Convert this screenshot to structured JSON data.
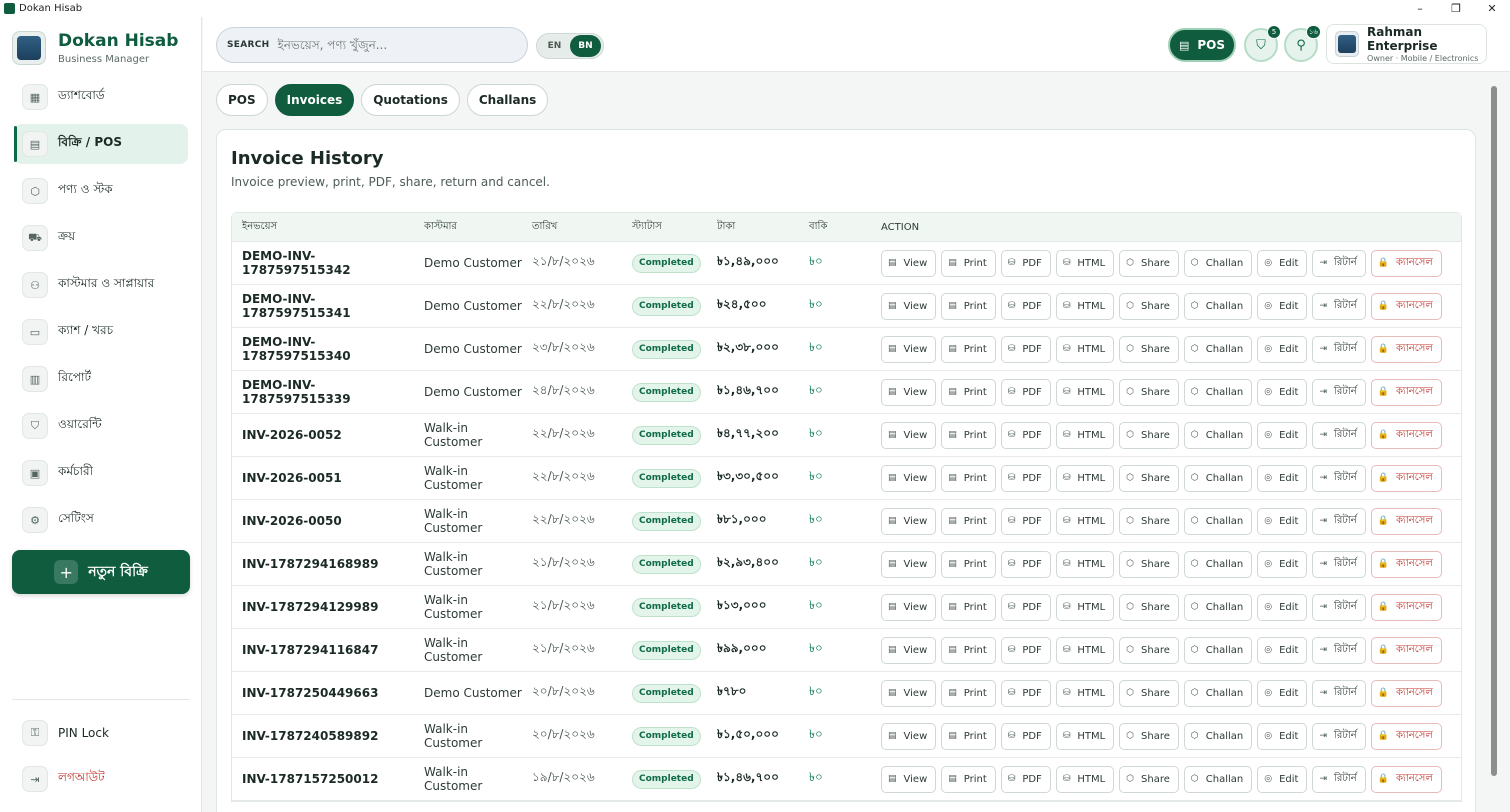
{
  "window": {
    "title": "Dokan Hisab",
    "controls": [
      "–",
      "❐",
      "✕"
    ]
  },
  "brand": {
    "name": "Dokan Hisab",
    "subtitle": "Business Manager"
  },
  "sidebar": {
    "items": [
      {
        "label": "ড্যাশবোর্ড",
        "icon": "dashboard-icon",
        "glyph": "▦"
      },
      {
        "label": "বিক্রি / POS",
        "icon": "receipt-icon",
        "glyph": "▤"
      },
      {
        "label": "পণ্য ও স্টক",
        "icon": "box-icon",
        "glyph": "⬡"
      },
      {
        "label": "ক্রয়",
        "icon": "truck-icon",
        "glyph": "⛟"
      },
      {
        "label": "কাস্টমার ও সাপ্লায়ার",
        "icon": "users-icon",
        "glyph": "⚇"
      },
      {
        "label": "ক্যাশ / খরচ",
        "icon": "wallet-icon",
        "glyph": "▭"
      },
      {
        "label": "রিপোর্ট",
        "icon": "bar-chart-icon",
        "glyph": "▥"
      },
      {
        "label": "ওয়ারেন্টি",
        "icon": "shield-check-icon",
        "glyph": "⛉"
      },
      {
        "label": "কর্মচারী",
        "icon": "calendar-icon",
        "glyph": "▣"
      },
      {
        "label": "সেটিংস",
        "icon": "settings-icon",
        "glyph": "⚙"
      }
    ],
    "active_index": 1,
    "new_sale_label": "নতুন বিক্রি",
    "pin_lock_label": "PIN Lock",
    "logout_label": "লগআউট"
  },
  "header": {
    "search_label": "SEARCH",
    "search_placeholder": "ইনভয়েস, পণ্য খুঁজুন...",
    "lang_en": "EN",
    "lang_bn": "BN",
    "lang_selected": "BN",
    "pos_label": "POS",
    "badge_1": "5",
    "badge_2": "১৬",
    "profile_name": "Rahman Enterprise",
    "profile_role": "Owner · Mobile / Electronics"
  },
  "tabs": [
    {
      "label": "POS",
      "active": false
    },
    {
      "label": "Invoices",
      "active": true
    },
    {
      "label": "Quotations",
      "active": false
    },
    {
      "label": "Challans",
      "active": false
    }
  ],
  "card": {
    "title": "Invoice History",
    "subtitle": "Invoice preview, print, PDF, share, return and cancel."
  },
  "table": {
    "headers": [
      "ইনভয়েস",
      "কাস্টমার",
      "তারিখ",
      "স্ট্যাটাস",
      "টাকা",
      "বাকি",
      "ACTION"
    ],
    "actions": [
      {
        "label": "View",
        "icon": "receipt-icon",
        "glyph": "▤"
      },
      {
        "label": "Print",
        "icon": "printer-icon",
        "glyph": "▤"
      },
      {
        "label": "PDF",
        "icon": "database-icon",
        "glyph": "⛁"
      },
      {
        "label": "HTML",
        "icon": "database-icon",
        "glyph": "⛁"
      },
      {
        "label": "Share",
        "icon": "share-icon",
        "glyph": "⬡"
      },
      {
        "label": "Challan",
        "icon": "box-icon",
        "glyph": "⬡"
      },
      {
        "label": "Edit",
        "icon": "edit-icon",
        "glyph": "◎"
      },
      {
        "label": "রিটার্ন",
        "icon": "return-icon",
        "glyph": "⇥"
      },
      {
        "label": "ক্যানসেল",
        "icon": "lock-icon",
        "glyph": "🔒"
      }
    ],
    "rows": [
      {
        "invoice": "DEMO-INV-1787597515342",
        "customer": "Demo Customer",
        "date": "২১/৮/২০২৬",
        "status": "Completed",
        "amount": "৳১,৪৯,০০০",
        "due": "৳০"
      },
      {
        "invoice": "DEMO-INV-1787597515341",
        "customer": "Demo Customer",
        "date": "২২/৮/২০২৬",
        "status": "Completed",
        "amount": "৳২৪,৫০০",
        "due": "৳০"
      },
      {
        "invoice": "DEMO-INV-1787597515340",
        "customer": "Demo Customer",
        "date": "২৩/৮/২০২৬",
        "status": "Completed",
        "amount": "৳২,৩৮,০০০",
        "due": "৳০"
      },
      {
        "invoice": "DEMO-INV-1787597515339",
        "customer": "Demo Customer",
        "date": "২৪/৮/২০২৬",
        "status": "Completed",
        "amount": "৳১,৪৬,৭০০",
        "due": "৳০"
      },
      {
        "invoice": "INV-2026-0052",
        "customer": "Walk-in Customer",
        "date": "২২/৮/২০২৬",
        "status": "Completed",
        "amount": "৳৪,৭৭,২০০",
        "due": "৳০"
      },
      {
        "invoice": "INV-2026-0051",
        "customer": "Walk-in Customer",
        "date": "২২/৮/২০২৬",
        "status": "Completed",
        "amount": "৳৩,৩০,৫০০",
        "due": "৳০"
      },
      {
        "invoice": "INV-2026-0050",
        "customer": "Walk-in Customer",
        "date": "২২/৮/২০২৬",
        "status": "Completed",
        "amount": "৳৮১,০০০",
        "due": "৳০"
      },
      {
        "invoice": "INV-1787294168989",
        "customer": "Walk-in Customer",
        "date": "২১/৮/২০২৬",
        "status": "Completed",
        "amount": "৳২,৯৩,৪০০",
        "due": "৳০"
      },
      {
        "invoice": "INV-1787294129989",
        "customer": "Walk-in Customer",
        "date": "২১/৮/২০২৬",
        "status": "Completed",
        "amount": "৳১৩,০০০",
        "due": "৳০"
      },
      {
        "invoice": "INV-1787294116847",
        "customer": "Walk-in Customer",
        "date": "২১/৮/২০২৬",
        "status": "Completed",
        "amount": "৳৯৯,০০০",
        "due": "৳০"
      },
      {
        "invoice": "INV-1787250449663",
        "customer": "Demo Customer",
        "date": "২০/৮/২০২৬",
        "status": "Completed",
        "amount": "৳৭৮০",
        "due": "৳০"
      },
      {
        "invoice": "INV-1787240589892",
        "customer": "Walk-in Customer",
        "date": "২০/৮/২০২৬",
        "status": "Completed",
        "amount": "৳১,৫০,০০০",
        "due": "৳০"
      },
      {
        "invoice": "INV-1787157250012",
        "customer": "Walk-in Customer",
        "date": "১৯/৮/২০২৬",
        "status": "Completed",
        "amount": "৳১,৪৬,৭০০",
        "due": "৳০"
      }
    ]
  }
}
